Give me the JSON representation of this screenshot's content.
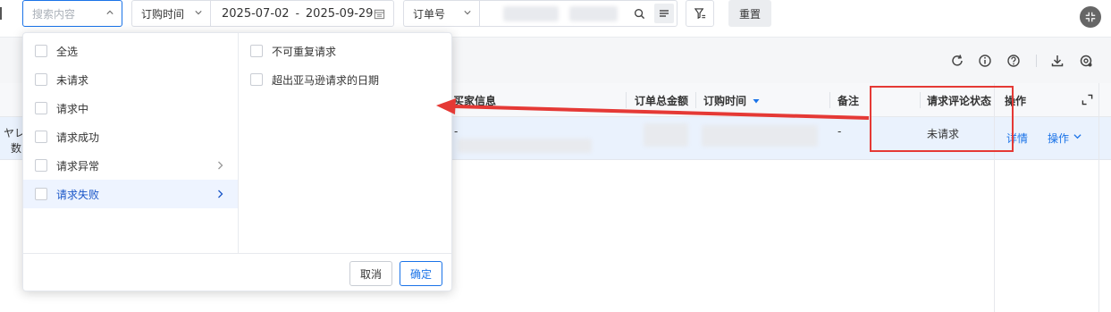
{
  "filters": {
    "search_placeholder": "搜索内容",
    "date_field": "订购时间",
    "date_start": "2025-07-02",
    "date_sep": "-",
    "date_end": "2025-09-29",
    "order_field": "订单号",
    "reset_label": "重置"
  },
  "dropdown": {
    "left_options": [
      {
        "label": "全选"
      },
      {
        "label": "未请求"
      },
      {
        "label": "请求中"
      },
      {
        "label": "请求成功"
      },
      {
        "label": "请求异常"
      },
      {
        "label": "请求失败"
      }
    ],
    "right_options": [
      {
        "label": "不可重复请求"
      },
      {
        "label": "超出亚马逊请求的日期"
      }
    ],
    "cancel_label": "取消",
    "confirm_label": "确定"
  },
  "table": {
    "headers": {
      "buyer_info": "买家信息",
      "order_total": "订单总金额",
      "order_time": "订购时间",
      "remark": "备注",
      "review_status": "请求评论状态",
      "action": "操作"
    },
    "row": {
      "left_snip1": "ヤレ",
      "left_snip2": "数",
      "buyer": "-",
      "remark": "-",
      "review_status": "未请求",
      "detail_link": "详情",
      "action_menu": "操作"
    }
  },
  "accent_color": "#1a73e8",
  "annotation_color": "#e53935"
}
